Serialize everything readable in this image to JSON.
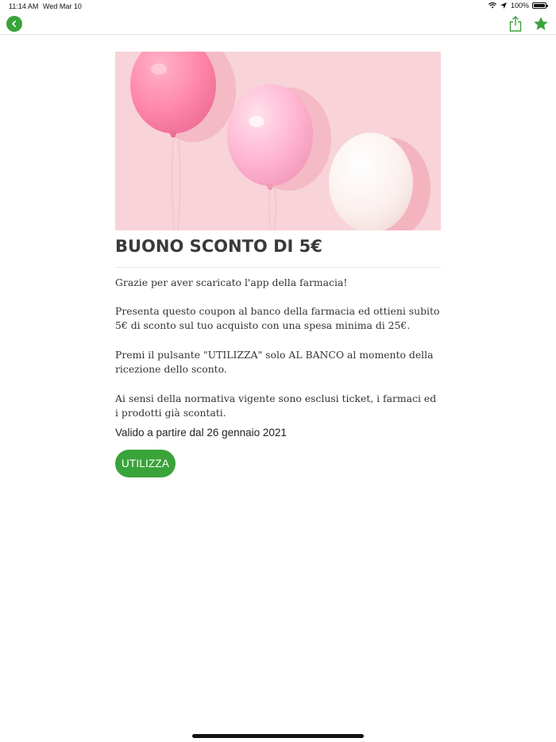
{
  "status_bar": {
    "time": "11:14 AM",
    "date": "Wed Mar 10",
    "battery": "100%",
    "battery_level": 1.0
  },
  "nav": {
    "back_icon": "chevron-left-icon",
    "share_icon": "share-icon",
    "favorite_icon": "star-icon"
  },
  "colors": {
    "accent": "#3aa33a",
    "hero_background": "#f8d3d9"
  },
  "coupon": {
    "title": "BUONO SCONTO DI 5€",
    "paragraphs": [
      "Grazie per aver scaricato l'app della farmacia!",
      "Presenta questo coupon al banco della farmacia ed ottieni subito 5€ di sconto sul tuo acquisto con una spesa minima di 25€.",
      "Premi il pulsante \"UTILIZZA\" solo AL BANCO al momento della ricezione dello sconto.",
      "Ai sensi della normativa vigente sono esclusi ticket, i farmaci ed i prodotti già scontati."
    ],
    "validity": "Valido a partire dal 26 gennaio 2021",
    "button_label": "UTILIZZA"
  }
}
